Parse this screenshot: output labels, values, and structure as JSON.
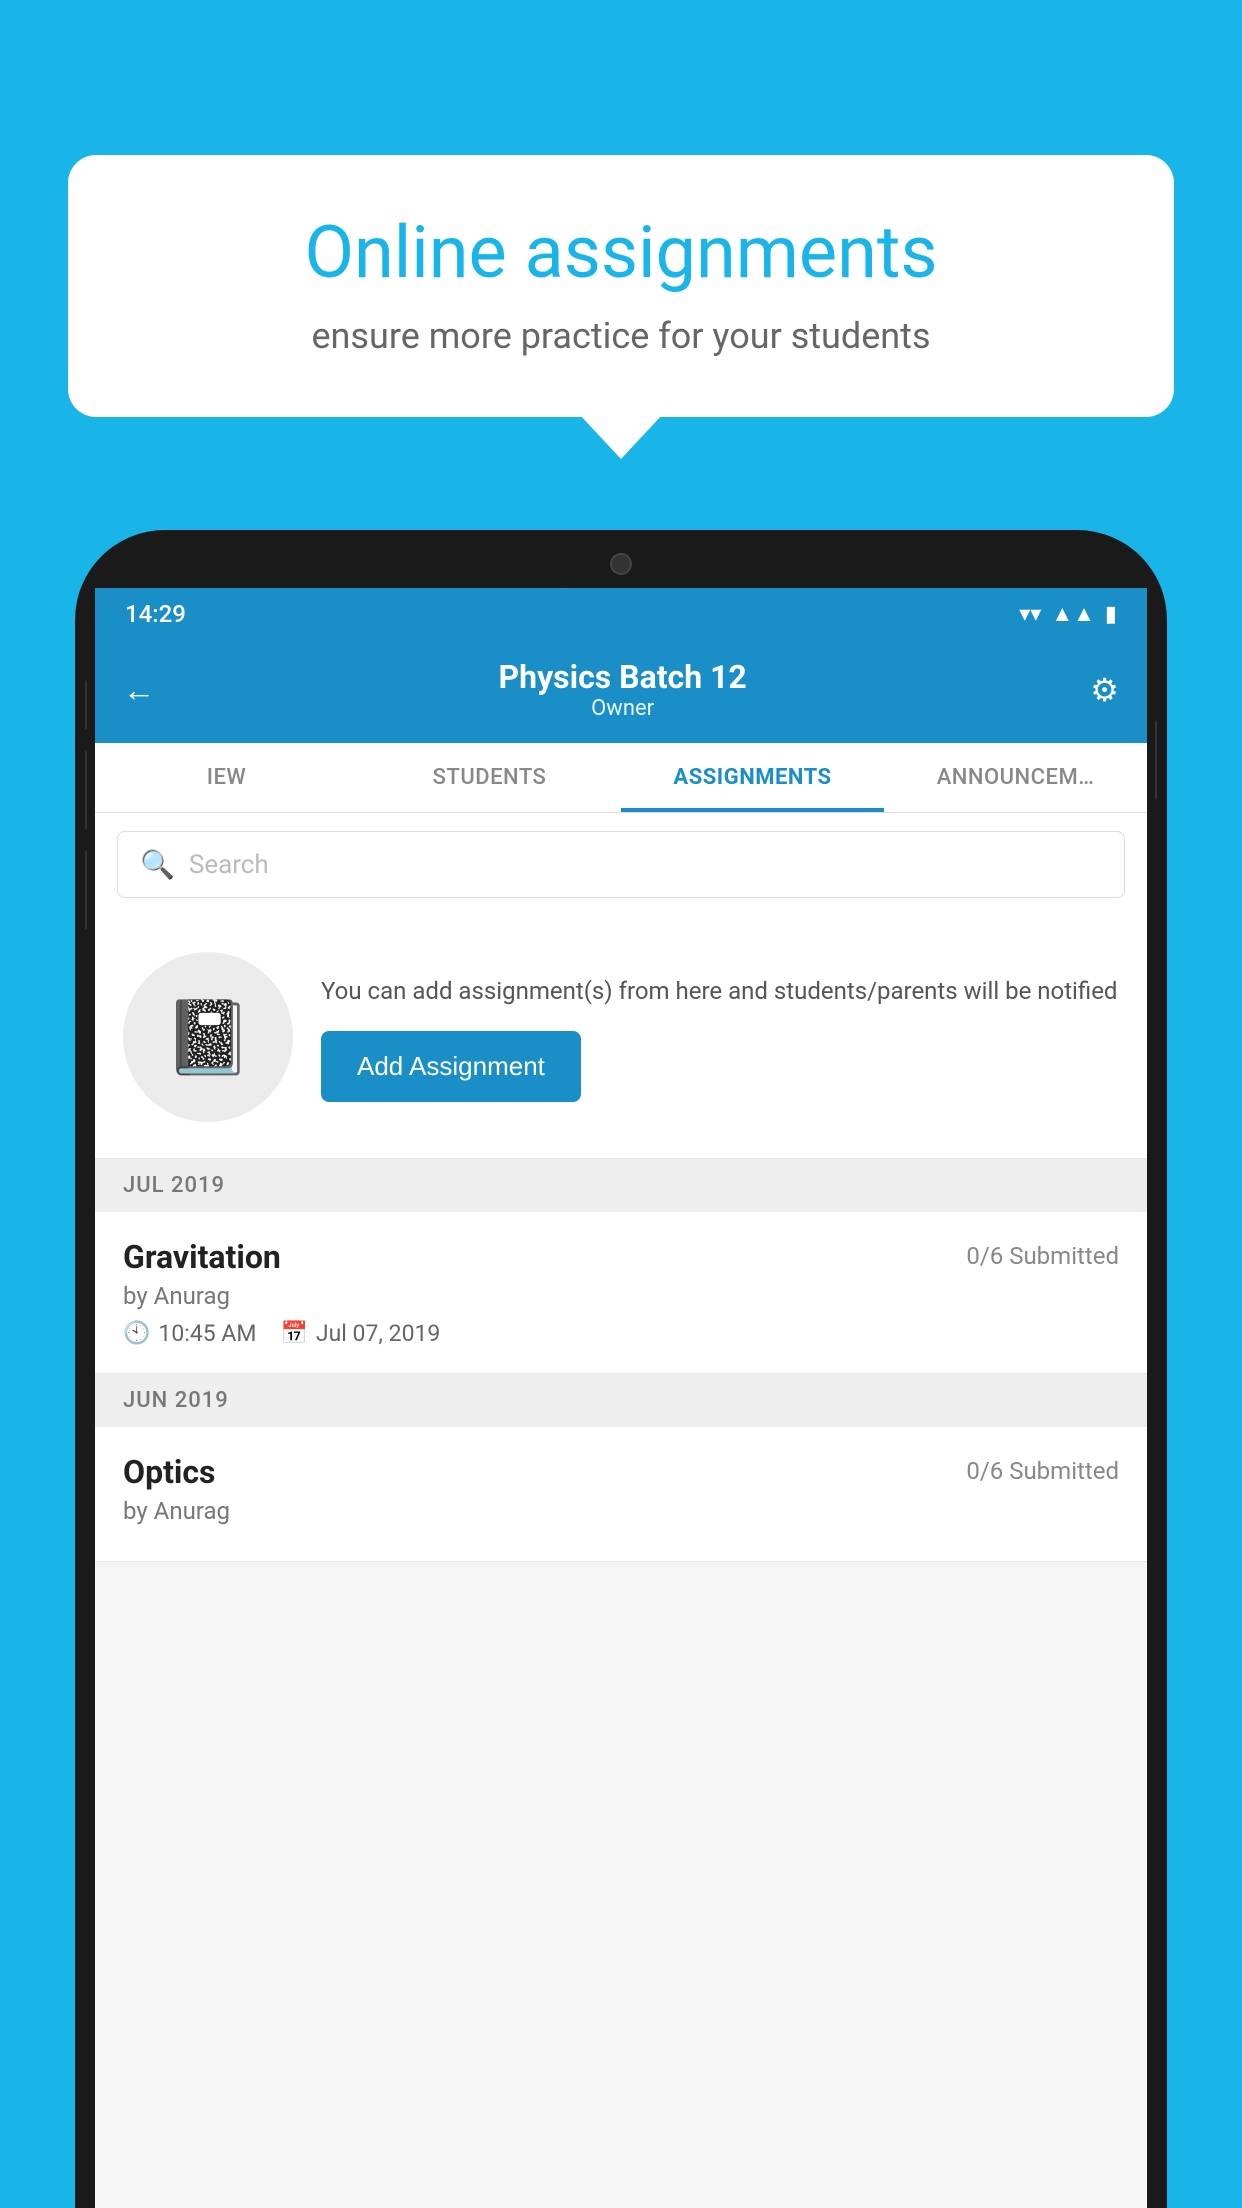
{
  "background_color": "#1ab5e8",
  "speech_bubble": {
    "title": "Online assignments",
    "subtitle": "ensure more practice for your students"
  },
  "phone": {
    "status_bar": {
      "time": "14:29",
      "icons": [
        "wifi",
        "signal",
        "battery"
      ]
    },
    "header": {
      "back_label": "←",
      "title": "Physics Batch 12",
      "subtitle": "Owner",
      "settings_label": "⚙"
    },
    "tabs": [
      {
        "label": "IEW",
        "active": false
      },
      {
        "label": "STUDENTS",
        "active": false
      },
      {
        "label": "ASSIGNMENTS",
        "active": true
      },
      {
        "label": "ANNOUNCEM…",
        "active": false
      }
    ],
    "search": {
      "placeholder": "Search"
    },
    "add_section": {
      "description": "You can add assignment(s) from here and students/parents will be notified",
      "button_label": "Add Assignment"
    },
    "month_sections": [
      {
        "month": "JUL 2019",
        "assignments": [
          {
            "name": "Gravitation",
            "submitted": "0/6 Submitted",
            "by": "by Anurag",
            "time": "10:45 AM",
            "date": "Jul 07, 2019"
          }
        ]
      },
      {
        "month": "JUN 2019",
        "assignments": [
          {
            "name": "Optics",
            "submitted": "0/6 Submitted",
            "by": "by Anurag",
            "time": "",
            "date": ""
          }
        ]
      }
    ]
  }
}
